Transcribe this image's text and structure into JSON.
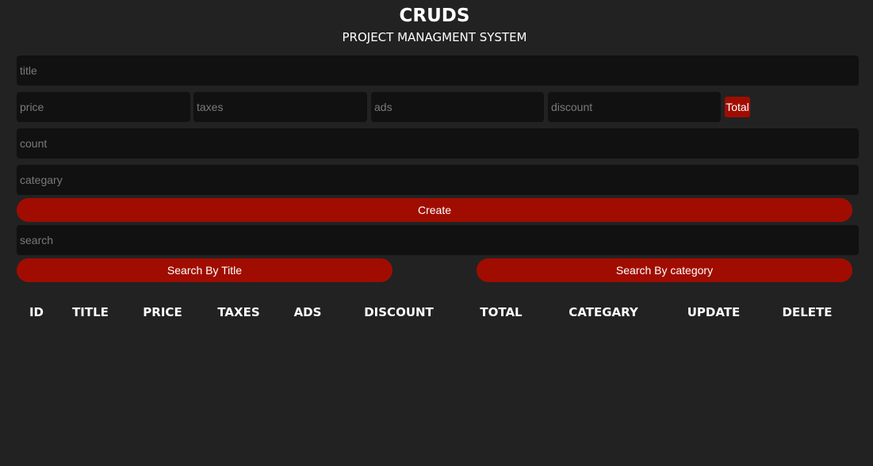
{
  "header": {
    "title": "CRUDS",
    "subtitle": "PROJECT MANAGMENT SYSTEM"
  },
  "form": {
    "title_placeholder": "title",
    "price_placeholder": "price",
    "taxes_placeholder": "taxes",
    "ads_placeholder": "ads",
    "discount_placeholder": "discount",
    "total_label": "Total",
    "count_placeholder": "count",
    "category_placeholder": "categary",
    "create_label": "Create"
  },
  "search": {
    "placeholder": "search",
    "by_title_label": "Search By Title",
    "by_category_label": "Search By category"
  },
  "table": {
    "headers": [
      "ID",
      "TITLE",
      "PRICE",
      "TAXES",
      "ADS",
      "DISCOUNT",
      "TOTAL",
      "CATEGARY",
      "UPDATE",
      "DELETE"
    ]
  },
  "colors": {
    "background": "#222222",
    "input_background": "#111111",
    "accent": "#a00d00",
    "text": "#ffffff",
    "placeholder": "#7a7a7a"
  }
}
